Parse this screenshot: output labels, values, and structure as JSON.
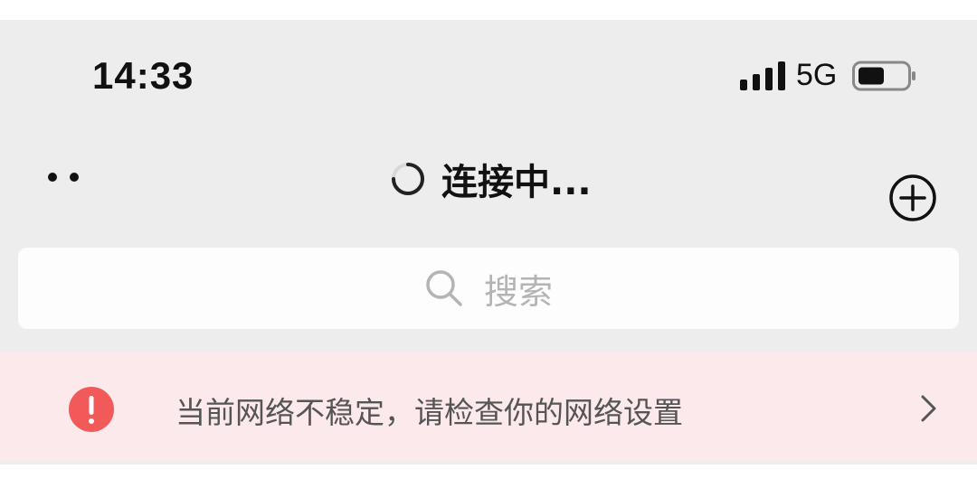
{
  "status_bar": {
    "time": "14:33",
    "network": "5G"
  },
  "nav": {
    "title": "连接中..."
  },
  "search": {
    "placeholder": "搜索"
  },
  "banner": {
    "message": "当前网络不稳定，请检查你的网络设置"
  },
  "icons": {
    "signal": "signal-bars-icon",
    "battery": "battery-icon",
    "more": "more-dots-icon",
    "spinner": "loading-spinner-icon",
    "add": "add-circle-icon",
    "search": "search-icon",
    "warning": "warning-icon",
    "chevron": "chevron-right-icon"
  },
  "colors": {
    "app_background": "#ededed",
    "banner_background": "#fbe9ec",
    "warning_red": "#f25a5a",
    "placeholder_gray": "#b4b4b4"
  }
}
